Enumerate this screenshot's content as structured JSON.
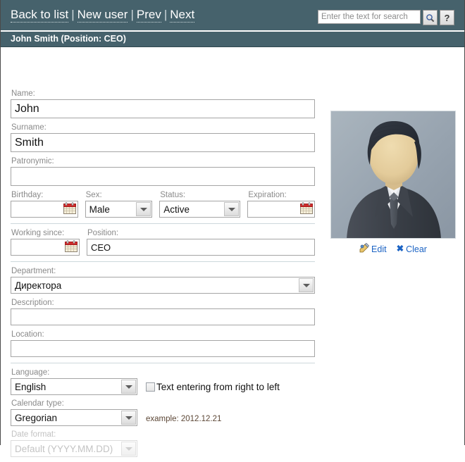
{
  "header": {
    "nav": [
      {
        "label": "Back to list",
        "name": "back-to-list-link"
      },
      {
        "label": "New user",
        "name": "new-user-link"
      },
      {
        "label": "Prev",
        "name": "prev-link"
      },
      {
        "label": "Next",
        "name": "next-link"
      }
    ],
    "separator": "|",
    "search": {
      "placeholder": "Enter the text for search",
      "value": "",
      "search_icon": "search-icon",
      "help_label": "?"
    },
    "title": "John Smith (Position: CEO)"
  },
  "form": {
    "name": {
      "label": "Name:",
      "value": "John"
    },
    "surname": {
      "label": "Surname:",
      "value": "Smith"
    },
    "patronymic": {
      "label": "Patronymic:",
      "value": ""
    },
    "birthday": {
      "label": "Birthday:",
      "value": "",
      "icon": "calendar-icon"
    },
    "sex": {
      "label": "Sex:",
      "value": "Male"
    },
    "status": {
      "label": "Status:",
      "value": "Active"
    },
    "expiration": {
      "label": "Expiration:",
      "value": "",
      "icon": "calendar-icon"
    },
    "working_since": {
      "label": "Working since:",
      "value": "",
      "icon": "calendar-icon"
    },
    "position": {
      "label": "Position:",
      "value": "CEO"
    },
    "department": {
      "label": "Department:",
      "value": "Директора"
    },
    "description": {
      "label": "Description:",
      "value": ""
    },
    "location": {
      "label": "Location:",
      "value": ""
    },
    "language": {
      "label": "Language:",
      "value": "English"
    },
    "rtl_checkbox": {
      "label": "Text entering from right to left",
      "checked": false
    },
    "calendar_type": {
      "label": "Calendar type:",
      "value": "Gregorian"
    },
    "calendar_example": "example: 2012.12.21",
    "date_format": {
      "label": "Date format:",
      "value": "Default (YYYY.MM.DD)",
      "disabled": true
    }
  },
  "photo": {
    "alt": "user-avatar",
    "edit": {
      "label": "Edit",
      "icon": "pencil-icon"
    },
    "clear": {
      "label": "Clear",
      "icon": "close-x-icon"
    }
  },
  "colors": {
    "header_bg": "#46626c",
    "title_bg": "#46626c",
    "link": "#1b63c4",
    "clear_x": "#c01a1a",
    "label": "#8a8a8a",
    "divider": "#cdd8dc",
    "example_text": "#5c4736"
  }
}
